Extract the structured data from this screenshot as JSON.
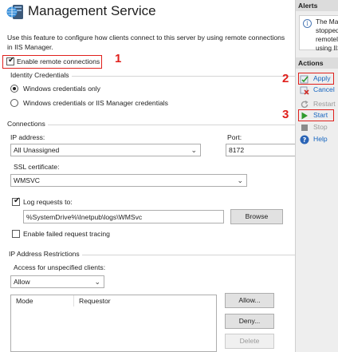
{
  "header": {
    "title": "Management Service",
    "description": "Use this feature to configure how clients connect to this server by using remote connections in IIS Manager."
  },
  "remote": {
    "enable_label": "Enable remote connections",
    "enabled": true
  },
  "identity": {
    "title": "Identity Credentials",
    "options": [
      "Windows credentials only",
      "Windows credentials or IIS Manager credentials"
    ],
    "selected": 0
  },
  "connections": {
    "title": "Connections",
    "ip_label": "IP address:",
    "ip_value": "All Unassigned",
    "port_label": "Port:",
    "port_value": "8172",
    "ssl_label": "SSL certificate:",
    "ssl_value": "WMSVC",
    "log_label": "Log requests to:",
    "log_checked": true,
    "log_path": "%SystemDrive%\\Inetpub\\logs\\WMSvc",
    "browse_label": "Browse",
    "failed_tracing_label": "Enable failed request tracing",
    "failed_tracing_checked": false
  },
  "ip_restrictions": {
    "title": "IP Address Restrictions",
    "access_label": "Access for unspecified clients:",
    "access_value": "Allow",
    "columns": [
      "Mode",
      "Requestor"
    ],
    "allow_button": "Allow...",
    "deny_button": "Deny...",
    "delete_button": "Delete"
  },
  "side": {
    "alerts_title": "Alerts",
    "alert_lines": [
      "The Mar",
      "stopped",
      "remotel",
      "using IIS"
    ],
    "actions_title": "Actions",
    "actions": [
      {
        "label": "Apply",
        "icon": "apply-icon",
        "enabled": true
      },
      {
        "label": "Cancel",
        "icon": "cancel-icon",
        "enabled": true
      },
      {
        "label": "Restart",
        "icon": "restart-icon",
        "enabled": false
      },
      {
        "label": "Start",
        "icon": "start-icon",
        "enabled": true
      },
      {
        "label": "Stop",
        "icon": "stop-icon",
        "enabled": false
      },
      {
        "label": "Help",
        "icon": "help-icon",
        "enabled": true
      }
    ]
  },
  "annotations": {
    "one": "1",
    "two": "2",
    "three": "3"
  },
  "colors": {
    "annotation_red": "#e0201c",
    "link_blue": "#1565c0"
  }
}
